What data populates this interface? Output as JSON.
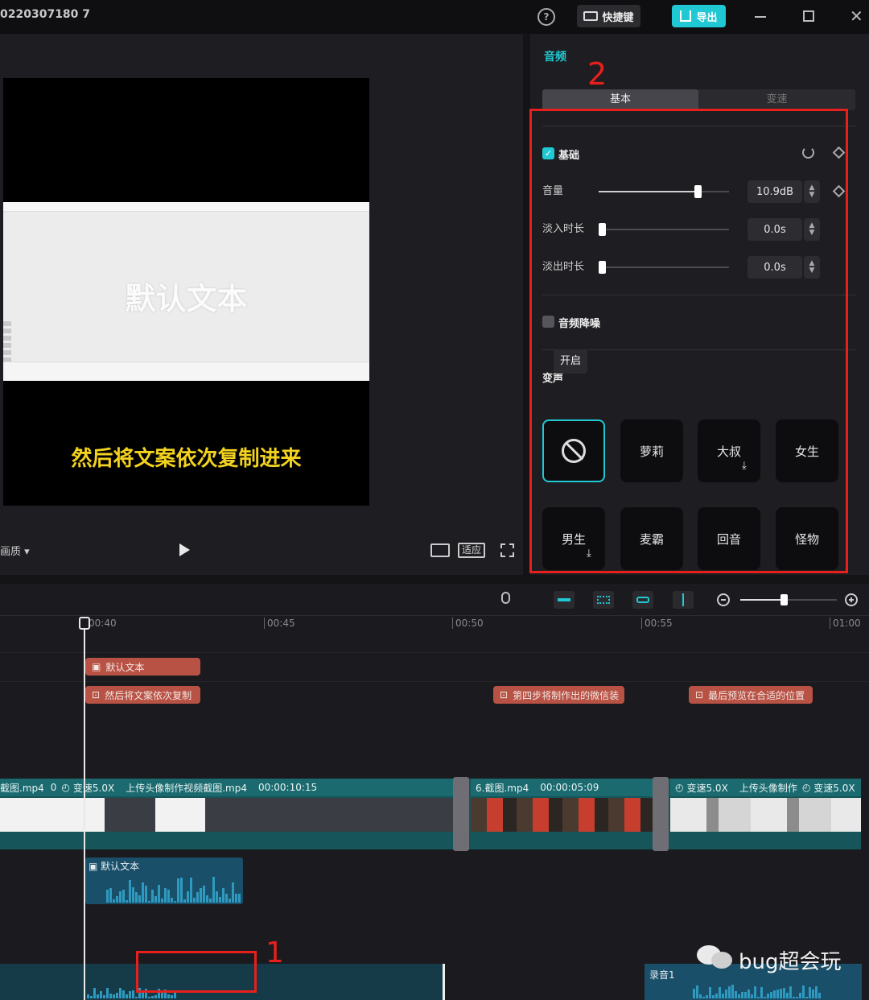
{
  "titlebar": {
    "project": "0220307180 7",
    "shortcut_label": "快捷键",
    "export_label": "导出"
  },
  "player": {
    "overlay_text": "默认文本",
    "subtitle": "然后将文案依次复制进来",
    "quality_label": "画质",
    "fit_label": "适应"
  },
  "inspector": {
    "panel_title": "音频",
    "tabs": [
      "基本",
      "变速"
    ],
    "section_basic": "基础",
    "volume": {
      "label": "音量",
      "value": "10.9dB",
      "level": 0.78
    },
    "fade_in": {
      "label": "淡入时长",
      "value": "0.0s",
      "level": 0
    },
    "fade_out": {
      "label": "淡出时长",
      "value": "0.0s",
      "level": 0
    },
    "denoise": "音频降噪",
    "tooltip": "开启",
    "voice_change": "变声",
    "voices": [
      "萝莉",
      "大叔",
      "女生",
      "男生",
      "麦霸",
      "回音",
      "怪物"
    ],
    "annotation_number": "2"
  },
  "timeline": {
    "zoom_level": 0.45,
    "ticks": [
      "00:40",
      "00:45",
      "00:50",
      "00:55",
      "01:00"
    ],
    "text_clips": [
      "默认文本",
      "然后将文案依次复制",
      "第四步将制作出的微信装",
      "最后预览在合适的位置"
    ],
    "video_clips": {
      "a_name": "截图.mp4",
      "a_num": "0",
      "speed": "变速5.0X",
      "b_name": "上传头像制作视频截图.mp4",
      "b_time": "00:00:10:15",
      "c_name": "6.截图.mp4",
      "c_time": "00:00:05:09",
      "d_speed": "变速5.0X",
      "d_name": "上传头像制作",
      "e_speed": "变速5.0X"
    },
    "audio_clip_label": "默认文本",
    "record_label": "录音1",
    "annotation_number": "1"
  },
  "watermark": "bug超会玩",
  "colors": {
    "accent": "#1fc8d3",
    "annotation_red": "#e8201c",
    "text_clip": "#b85244",
    "video_track": "#1b6a6f"
  }
}
